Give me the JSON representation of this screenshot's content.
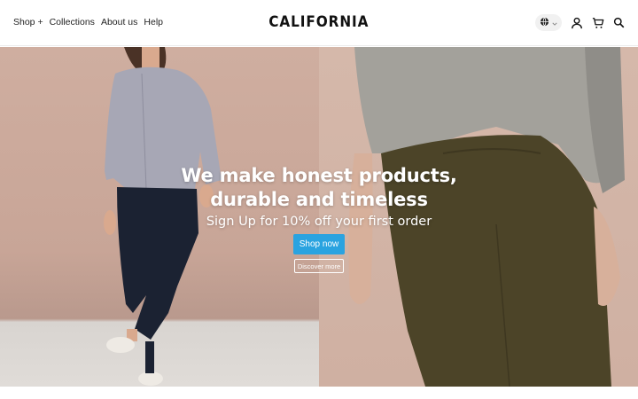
{
  "header": {
    "nav": [
      {
        "label": "Shop +"
      },
      {
        "label": "Collections"
      },
      {
        "label": "About us"
      },
      {
        "label": "Help"
      }
    ],
    "logo": "CALIFORNIA",
    "icons": [
      "globe-icon",
      "chevron-down-icon",
      "user-icon",
      "cart-icon",
      "search-icon"
    ]
  },
  "hero": {
    "headline_line1": "We make honest products,",
    "headline_line2": "durable and timeless",
    "subheadline": "Sign Up for 10% off your first order",
    "primary_cta": "Shop now",
    "secondary_cta": "Discover more"
  },
  "colors": {
    "accent": "#2aa3e0",
    "hero_left": "#cfaea0",
    "hero_right": "#d5b8aa"
  }
}
